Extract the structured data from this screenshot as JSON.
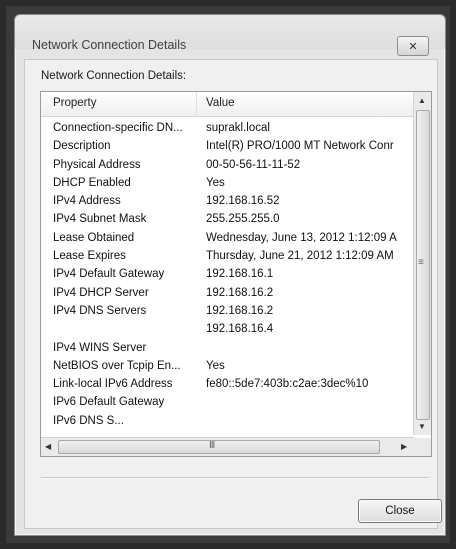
{
  "window": {
    "title": "Network Connection Details"
  },
  "section_label": "Network Connection Details:",
  "table": {
    "columns": [
      "Property",
      "Value"
    ],
    "rows": [
      {
        "property": "Connection-specific DN...",
        "value": "suprakl.local"
      },
      {
        "property": "Description",
        "value": "Intel(R) PRO/1000 MT Network Conr"
      },
      {
        "property": "Physical Address",
        "value": "00-50-56-11-11-52"
      },
      {
        "property": "DHCP Enabled",
        "value": "Yes"
      },
      {
        "property": "IPv4 Address",
        "value": "192.168.16.52"
      },
      {
        "property": "IPv4 Subnet Mask",
        "value": "255.255.255.0"
      },
      {
        "property": "Lease Obtained",
        "value": "Wednesday, June 13, 2012 1:12:09 A"
      },
      {
        "property": "Lease Expires",
        "value": "Thursday, June 21, 2012 1:12:09 AM"
      },
      {
        "property": "IPv4 Default Gateway",
        "value": "192.168.16.1"
      },
      {
        "property": "IPv4 DHCP Server",
        "value": "192.168.16.2"
      },
      {
        "property": "IPv4 DNS Servers",
        "value": "192.168.16.2"
      },
      {
        "property": "",
        "value": "192.168.16.4"
      },
      {
        "property": "IPv4 WINS Server",
        "value": ""
      },
      {
        "property": "NetBIOS over Tcpip En...",
        "value": "Yes"
      },
      {
        "property": "Link-local IPv6 Address",
        "value": "fe80::5de7:403b:c2ae:3dec%10"
      },
      {
        "property": "IPv6 Default Gateway",
        "value": ""
      },
      {
        "property": "IPv6 DNS S...",
        "value": ""
      }
    ]
  },
  "scrollbar": {
    "up_arrow": "▲",
    "down_arrow": "▼",
    "left_arrow": "◀",
    "right_arrow": "▶",
    "grip": "≡",
    "h_grip": "III"
  },
  "buttons": {
    "close_label": "Close"
  },
  "icons": {
    "title_close": "✕"
  }
}
